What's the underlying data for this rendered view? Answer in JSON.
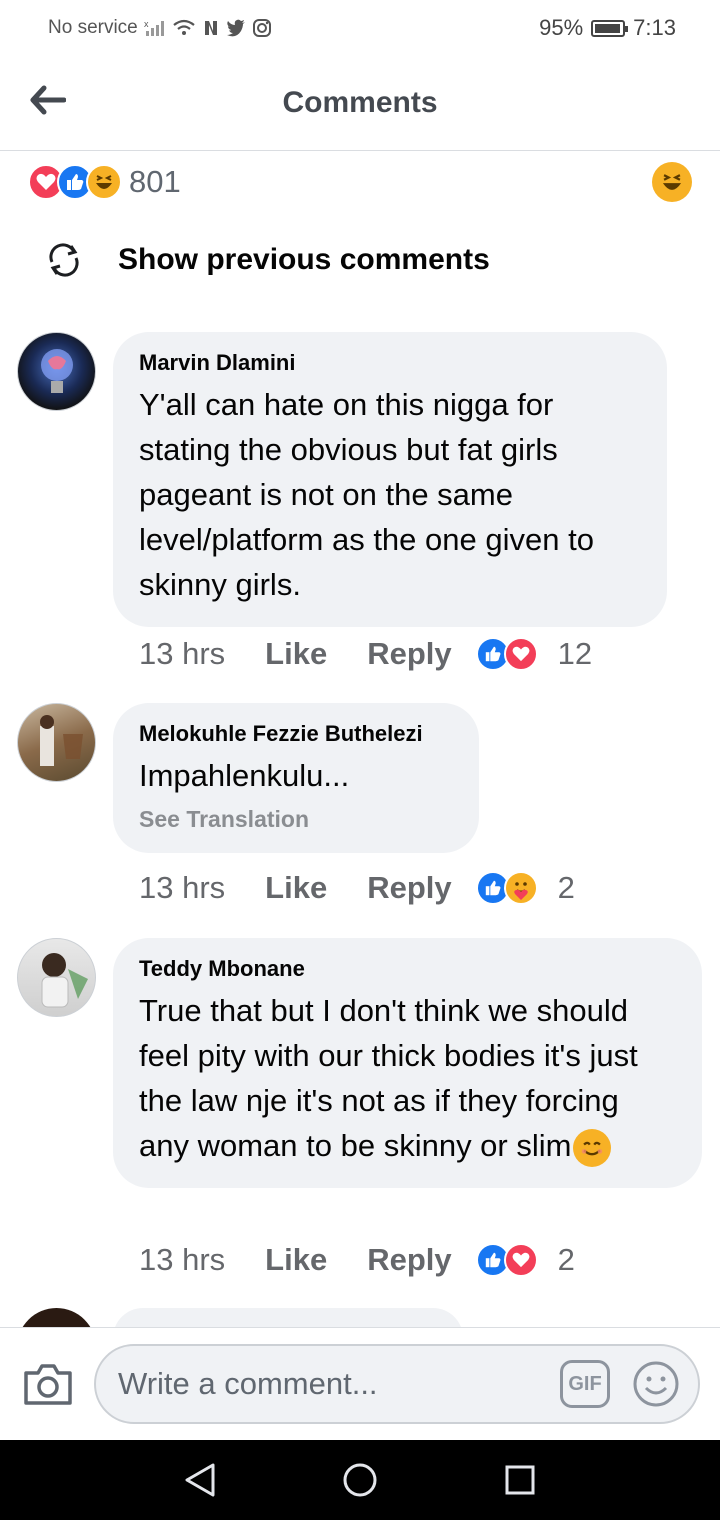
{
  "status_bar": {
    "carrier": "No service",
    "battery": "95%",
    "battery_level": 0.95,
    "time": "7:13"
  },
  "header": {
    "title": "Comments"
  },
  "reactions_summary": {
    "count": "801",
    "icons": [
      "love-icon",
      "like-icon",
      "haha-icon"
    ],
    "top_reaction": "haha-icon"
  },
  "show_previous": {
    "label": "Show previous comments"
  },
  "comments": [
    {
      "author": "Marvin Dlamini",
      "text": "Y'all can hate on this nigga for stating the obvious but fat girls pageant is not on the same level/platform as the one given to skinny girls.",
      "time": "13 hrs",
      "like_label": "Like",
      "reply_label": "Reply",
      "reactions": [
        "like-icon",
        "love-icon"
      ],
      "reaction_count": "12"
    },
    {
      "author": "Melokuhle Fezzie Buthelezi",
      "text": "Impahlenkulu...",
      "see_translation": "See Translation",
      "time": "13 hrs",
      "like_label": "Like",
      "reply_label": "Reply",
      "reactions": [
        "like-icon",
        "care-icon"
      ],
      "reaction_count": "2"
    },
    {
      "author": "Teddy Mbonane",
      "text": "True that but I don't think we should feel pity with our thick bodies it's just the law nje it's not as if they forcing any woman to be skinny or slim",
      "time": "13 hrs",
      "like_label": "Like",
      "reply_label": "Reply",
      "reactions": [
        "like-icon",
        "love-icon"
      ],
      "reaction_count": "2"
    }
  ],
  "composer": {
    "placeholder": "Write a comment...",
    "gif_label": "GIF"
  },
  "colors": {
    "like_blue": "#1877f2",
    "love_red": "#f33e58",
    "haha_yellow": "#f7b125",
    "bubble_bg": "#f0f2f5"
  }
}
